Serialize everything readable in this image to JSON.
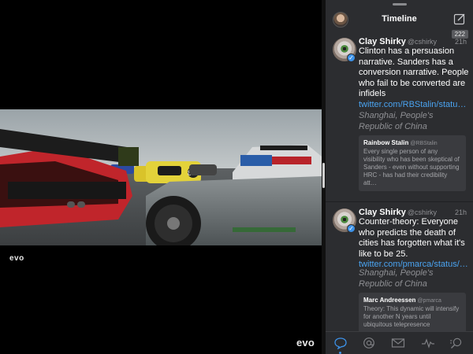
{
  "video": {
    "watermark_small": "evo",
    "watermark_large": "evo"
  },
  "timeline": {
    "title": "Timeline",
    "unread_count": "222"
  },
  "tweets": [
    {
      "name": "Clay Shirky",
      "handle": "@cshirky",
      "time": "21h",
      "text": "Clinton has a persuasion narrative. Sanders has a conversion narrative. People who fail to be converted are infidels ",
      "link": "twitter.com/RBStalin/statu…",
      "location": "Shanghai, People's Republic of China",
      "quote": {
        "name": "Rainbow Stalin",
        "handle": "@RBStalin",
        "text": "Every single person of any visibility who has been skeptical of Sanders - even without supporting HRC - has had their credibility att…"
      }
    },
    {
      "name": "Clay Shirky",
      "handle": "@cshirky",
      "time": "21h",
      "text": "Counter-theory: Everyone who predicts the death of cities has forgotten what it's like to be 25. ",
      "link": "twitter.com/pmarca/status/…",
      "location": "Shanghai, People's Republic of China",
      "quote": {
        "name": "Marc Andreessen",
        "handle": "@pmarca",
        "text": "Theory: This dynamic will intensify for another N years until ubiquitous telepresence"
      }
    }
  ],
  "tabbar": {
    "tabs": [
      "timeline-tab",
      "mentions-tab",
      "messages-tab",
      "activity-tab",
      "search-tab"
    ],
    "active": "timeline-tab",
    "accent": "#3d92e8"
  }
}
